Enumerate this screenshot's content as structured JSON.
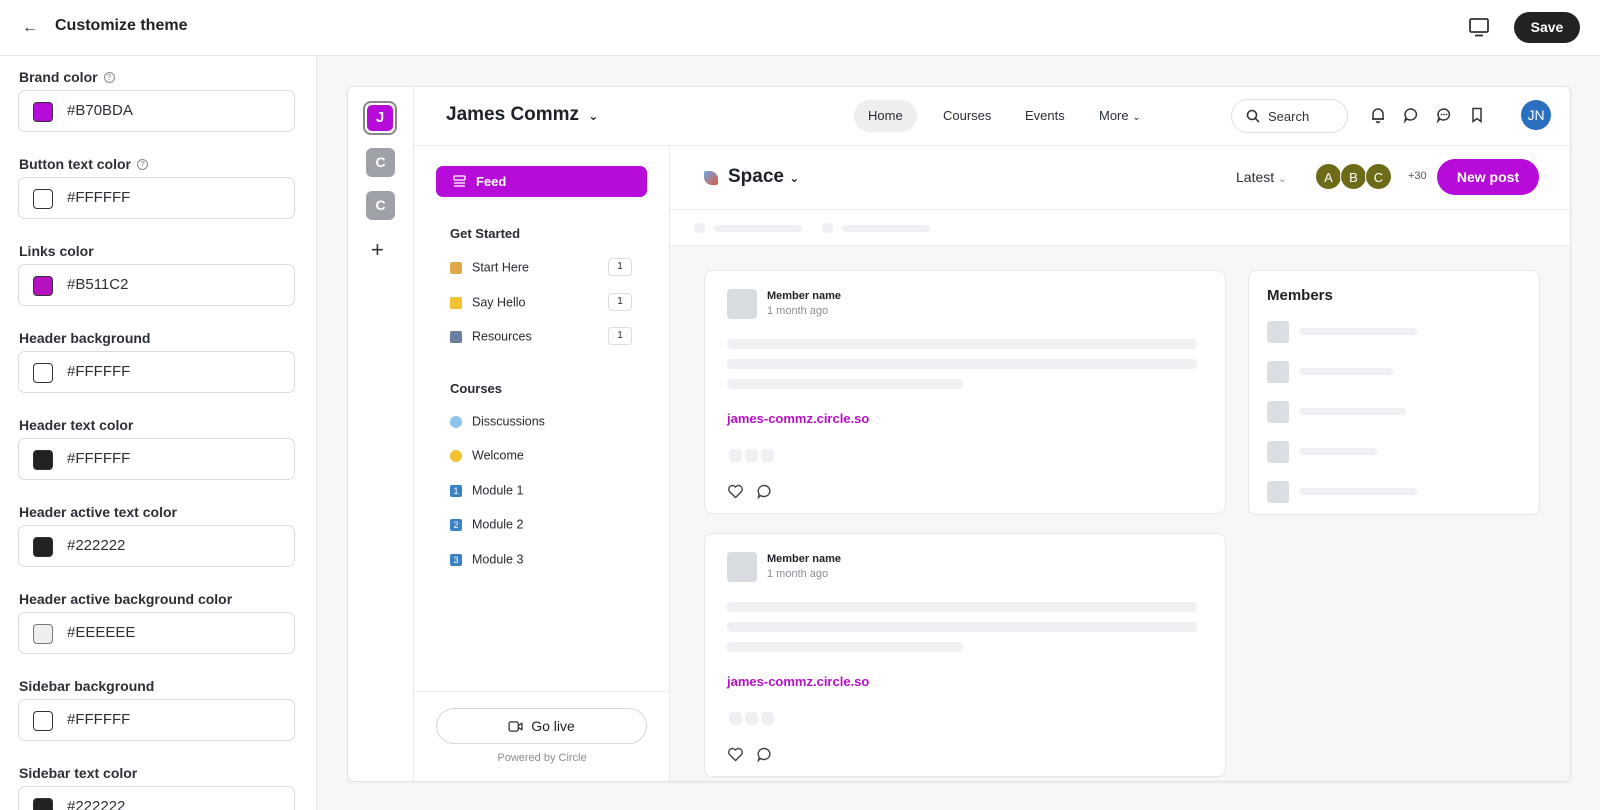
{
  "topbar": {
    "title": "Customize theme",
    "save_label": "Save"
  },
  "settings": [
    {
      "label": "Brand color",
      "value": "#B70BDA",
      "help": true
    },
    {
      "label": "Button text color",
      "value": "#FFFFFF",
      "help": true
    },
    {
      "label": "Links color",
      "value": "#B511C2",
      "help": false
    },
    {
      "label": "Header background",
      "value": "#FFFFFF",
      "help": false
    },
    {
      "label": "Header text color",
      "value": "#FFFFFF",
      "help": false
    },
    {
      "label": "Header active text color",
      "value": "#222222",
      "help": false
    },
    {
      "label": "Header active background color",
      "value": "#EEEEEE",
      "help": false
    },
    {
      "label": "Sidebar background",
      "value": "#FFFFFF",
      "help": false
    },
    {
      "label": "Sidebar text color",
      "value": "#222222",
      "help": false
    }
  ],
  "swatch_colors": [
    "#B70BDA",
    "#FFFFFF",
    "#B511C2",
    "#FFFFFF",
    "#222222",
    "#222222",
    "#EEEEEE",
    "#FFFFFF",
    "#222222"
  ],
  "preview": {
    "rail": {
      "active": "J",
      "others": [
        "C",
        "C"
      ],
      "add": "+"
    },
    "community_name": "James Commz",
    "nav": [
      "Home",
      "Courses",
      "Events",
      "More"
    ],
    "search_label": "Search",
    "user_initials": "JN",
    "sidebar": {
      "feed_label": "Feed",
      "sections": [
        {
          "title": "Get Started",
          "items": [
            {
              "label": "Start Here",
              "count": "1",
              "icon": "house-icon",
              "color": "#e0a84a"
            },
            {
              "label": "Say Hello",
              "count": "1",
              "icon": "wave-icon",
              "color": "#f2c230"
            },
            {
              "label": "Resources",
              "count": "1",
              "icon": "book-icon",
              "color": "#6b7fa0"
            }
          ]
        },
        {
          "title": "Courses",
          "items": [
            {
              "label": "Disscussions",
              "icon": "speech-bubble-icon",
              "color": "#8ec5f0"
            },
            {
              "label": "Welcome",
              "icon": "handshake-icon",
              "color": "#f2c230"
            },
            {
              "label": "Module 1",
              "icon": "keycap-1-icon",
              "color": "#3b82c4"
            },
            {
              "label": "Module 2",
              "icon": "keycap-2-icon",
              "color": "#3b82c4"
            },
            {
              "label": "Module 3",
              "icon": "keycap-3-icon",
              "color": "#3b82c4"
            }
          ]
        }
      ],
      "go_live": "Go live",
      "powered_by": "Powered by Circle"
    },
    "space": {
      "name": "Space",
      "sort": "Latest",
      "member_avatars": [
        "A",
        "B",
        "C"
      ],
      "more_members": "+30",
      "new_post": "New post"
    },
    "posts": [
      {
        "author": "Member name",
        "time": "1 month ago",
        "link": "james-commz.circle.so"
      },
      {
        "author": "Member name",
        "time": "1 month ago",
        "link": "james-commz.circle.so"
      }
    ],
    "members_title": "Members"
  }
}
